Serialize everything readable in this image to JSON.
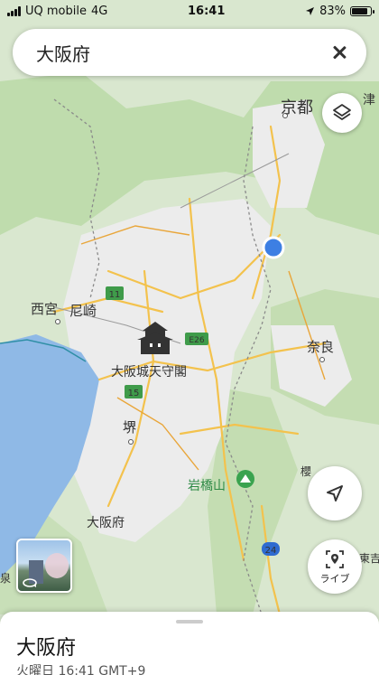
{
  "status_bar": {
    "carrier": "UQ mobile",
    "network": "4G",
    "time": "16:41",
    "battery": "83%",
    "battery_level": 0.83
  },
  "search": {
    "query": "大阪府"
  },
  "map": {
    "city_labels": [
      {
        "id": "kyoto",
        "text": "京都"
      },
      {
        "id": "nishinomiya",
        "text": "西宮"
      },
      {
        "id": "amagasaki",
        "text": "尼崎"
      },
      {
        "id": "nara",
        "text": "奈良"
      },
      {
        "id": "sakai",
        "text": "堺"
      },
      {
        "id": "osaka-pref",
        "text": "大阪府"
      },
      {
        "id": "osaka-castle",
        "text": "大阪城天守閣"
      },
      {
        "id": "iwahashiyama",
        "text": "岩橋山"
      },
      {
        "id": "edge-sakura",
        "text": "櫻"
      },
      {
        "id": "edge-left",
        "text": "泉"
      },
      {
        "id": "edge-right",
        "text": "東吉"
      },
      {
        "id": "edge-right-top",
        "text": "津"
      }
    ],
    "route_shields": [
      {
        "id": "r11",
        "text": "11",
        "color": "#3f9b4a"
      },
      {
        "id": "r15",
        "text": "15",
        "color": "#3f9b4a"
      },
      {
        "id": "r24",
        "text": "24",
        "color": "#2f6bd0"
      },
      {
        "id": "e26",
        "text": "E26",
        "color": "#3f9b4a"
      }
    ],
    "colors": {
      "water": "#8fb9e6",
      "urban": "#ebebeb",
      "forest": "#bcd9a9",
      "road": "#f3c24d",
      "border": "#8a8a8a",
      "location": "#3d7fe3"
    }
  },
  "controls": {
    "live_label": "ライブ"
  },
  "place_sheet": {
    "title": "大阪府",
    "subtitle": "火曜日 16:41 GMT+9"
  }
}
